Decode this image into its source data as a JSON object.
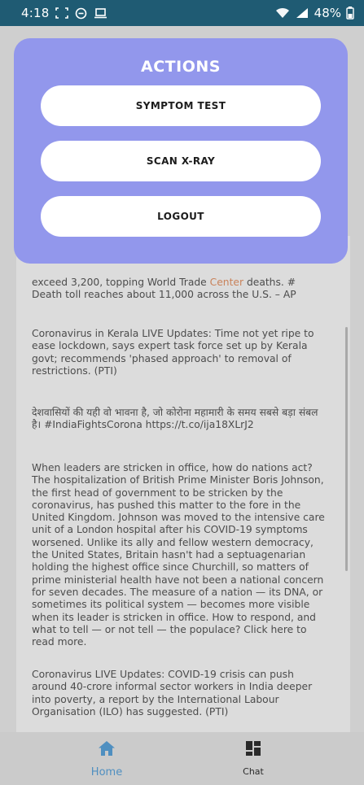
{
  "status_bar": {
    "time": "4:18",
    "battery_percent": "48%",
    "icons_left": [
      "screenshot-frame-icon",
      "minus-circle-icon",
      "laptop-icon"
    ],
    "icons_right": [
      "wifi-icon",
      "signal-icon",
      "battery-icon"
    ]
  },
  "actions": {
    "title": "ACTIONS",
    "buttons": [
      {
        "label": "SYMPTOM TEST"
      },
      {
        "label": "SCAN X-RAY"
      },
      {
        "label": "LOGOUT"
      }
    ]
  },
  "feed": {
    "items": [
      {
        "text_start": "exceed 3,200, topping World Trade ",
        "text_accent": "Center",
        "text_end": " deaths. # Death toll reaches about 11,000 across the U.S. – AP"
      },
      {
        "text": "Coronavirus in Kerala LIVE Updates: Time not yet ripe to ease lockdown, says expert task force set up by Kerala govt; recommends 'phased approach' to removal of restrictions. (PTI)"
      },
      {
        "text": "देशवासियों की यही वो भावना है, जो कोरोना महामारी के समय सबसे बड़ा संबल है। #IndiaFightsCorona https://t.co/ija18XLrJ2"
      },
      {
        "text": "When leaders are stricken in office, how do nations act? The hospitalization of British Prime Minister Boris Johnson, the first head of government to be stricken by the coronavirus, has pushed this matter to the fore in the United Kingdom. Johnson was moved to the intensive care unit of a London hospital after his COVID-19 symptoms worsened. Unlike its ally and fellow western democracy, the United States, Britain hasn't had a septuagenarian holding the highest office since Churchill, so matters of prime ministerial health have not been a national concern for seven decades. The measure of a nation — its DNA, or sometimes its political system — becomes more visible when its leader is stricken in office. How to respond, and what to tell — or not tell — the populace? Click here to read more."
      },
      {
        "text": "Coronavirus LIVE Updates: COVID-19 crisis can push around 40-crore informal sector workers in India deeper into poverty, a report by the International Labour Organisation (ILO) has suggested. (PTI)"
      }
    ]
  },
  "bottom_nav": {
    "items": [
      {
        "label": "Home",
        "icon": "home-icon",
        "active": true
      },
      {
        "label": "Chat",
        "icon": "dashboard-icon",
        "active": false
      }
    ]
  },
  "colors": {
    "status_bar": "#1f5b73",
    "actions_card": "#9297ec",
    "nav_active": "#4f8fc0",
    "feed_accent": "#c9825a"
  }
}
